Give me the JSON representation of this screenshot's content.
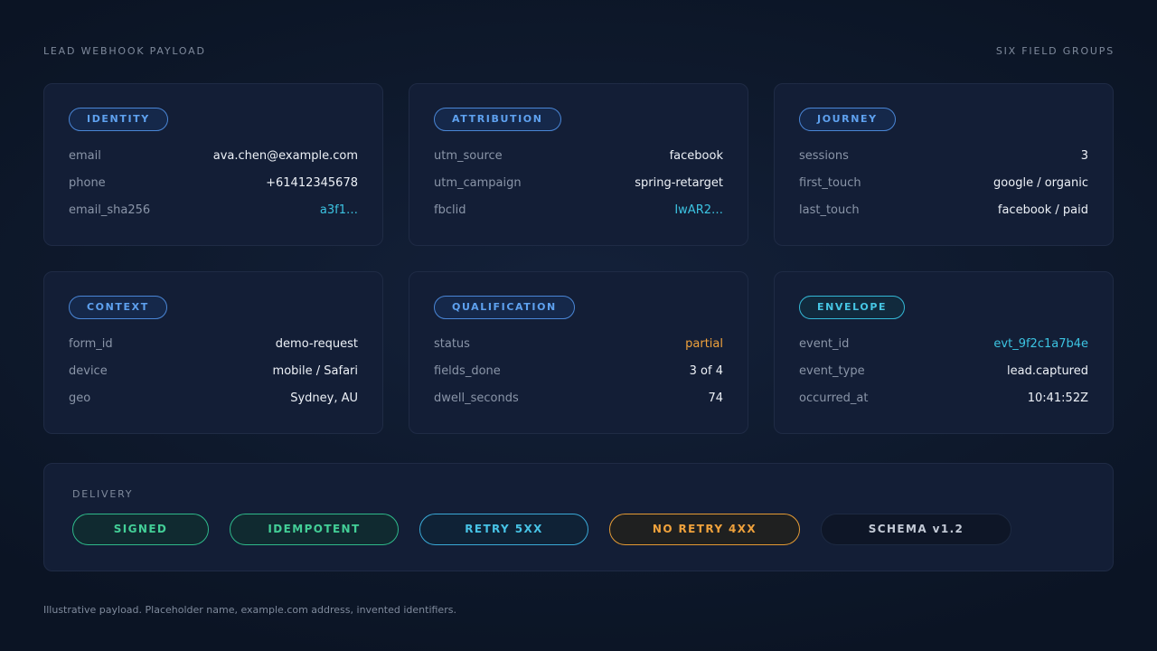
{
  "header": {
    "title": "LEAD WEBHOOK PAYLOAD",
    "subtitle": "SIX FIELD GROUPS"
  },
  "cards": [
    {
      "label": "IDENTITY",
      "accent": "#5ea1ef",
      "fields": [
        {
          "key": "email",
          "value": "ava.chen@example.com"
        },
        {
          "key": "phone",
          "value": "+61412345678"
        },
        {
          "key": "email_sha256",
          "value": "a3f1…"
        }
      ]
    },
    {
      "label": "ATTRIBUTION",
      "accent": "#5ea1ef",
      "fields": [
        {
          "key": "utm_source",
          "value": "facebook"
        },
        {
          "key": "utm_campaign",
          "value": "spring-retarget"
        },
        {
          "key": "fbclid",
          "value": "IwAR2…"
        }
      ]
    },
    {
      "label": "JOURNEY",
      "accent": "#5ea1ef",
      "fields": [
        {
          "key": "sessions",
          "value": "3"
        },
        {
          "key": "first_touch",
          "value": "google / organic"
        },
        {
          "key": "last_touch",
          "value": "facebook / paid"
        }
      ]
    },
    {
      "label": "CONTEXT",
      "accent": "#5ea1ef",
      "fields": [
        {
          "key": "form_id",
          "value": "demo-request"
        },
        {
          "key": "device",
          "value": "mobile / Safari"
        },
        {
          "key": "geo",
          "value": "Sydney, AU"
        }
      ]
    },
    {
      "label": "QUALIFICATION",
      "accent": "#5ea1ef",
      "fields": [
        {
          "key": "status",
          "value": "partial"
        },
        {
          "key": "fields_done",
          "value": "3 of 4"
        },
        {
          "key": "dwell_seconds",
          "value": "74"
        }
      ]
    },
    {
      "label": "ENVELOPE",
      "accent": "#46c6e4",
      "fields": [
        {
          "key": "event_id",
          "value": "evt_9f2c1a7b4e"
        },
        {
          "key": "event_type",
          "value": "lead.captured"
        },
        {
          "key": "occurred_at",
          "value": "10:41:52Z"
        }
      ]
    }
  ],
  "delivery": {
    "label": "DELIVERY",
    "tags": [
      {
        "text": "SIGNED",
        "color": "#43cf97"
      },
      {
        "text": "IDEMPOTENT",
        "color": "#43cf97"
      },
      {
        "text": "RETRY 5XX",
        "color": "#47c3e6"
      },
      {
        "text": "NO RETRY 4XX",
        "color": "#f0a23c"
      },
      {
        "text": "SCHEMA v1.2",
        "color": "#c3cad6"
      }
    ]
  },
  "footnote": "Illustrative payload. Placeholder name, example.com address, invented identifiers."
}
